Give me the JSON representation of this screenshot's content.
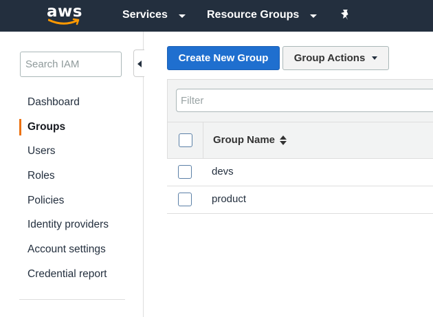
{
  "topnav": {
    "logo_text": "aws",
    "services_label": "Services",
    "resource_groups_label": "Resource Groups",
    "pin_icon": "pushpin-icon",
    "background": "#232f3e"
  },
  "sidebar": {
    "search_placeholder": "Search IAM",
    "items": [
      {
        "label": "Dashboard",
        "active": false
      },
      {
        "label": "Groups",
        "active": true
      },
      {
        "label": "Users",
        "active": false
      },
      {
        "label": "Roles",
        "active": false
      },
      {
        "label": "Policies",
        "active": false
      },
      {
        "label": "Identity providers",
        "active": false
      },
      {
        "label": "Account settings",
        "active": false
      },
      {
        "label": "Credential report",
        "active": false
      }
    ],
    "active_accent": "#ec7211"
  },
  "toolbar": {
    "create_label": "Create New Group",
    "actions_label": "Group Actions",
    "primary_color": "#1f6fcf"
  },
  "table": {
    "filter_placeholder": "Filter",
    "columns": [
      "Group Name"
    ],
    "rows": [
      {
        "name": "devs"
      },
      {
        "name": "product"
      }
    ]
  }
}
